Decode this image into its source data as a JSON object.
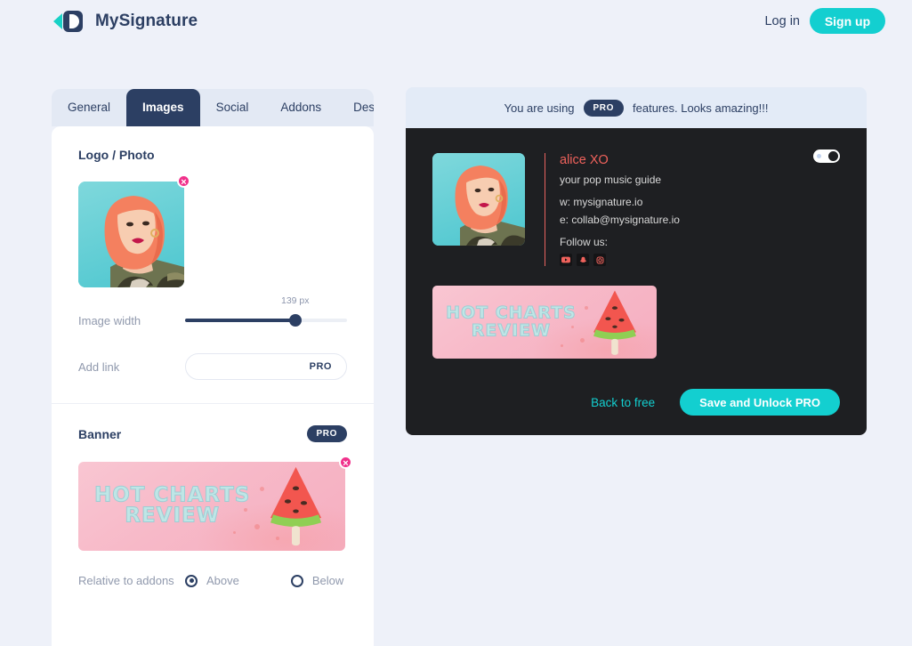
{
  "header": {
    "brand_name": "MySignature",
    "login_label": "Log in",
    "signup_label": "Sign up",
    "logo_icon": "mysignature-logo-icon",
    "accent_color": "#13cfd0",
    "navy_color": "#2c3f63"
  },
  "editor": {
    "tabs": [
      {
        "label": "General",
        "active": false
      },
      {
        "label": "Images",
        "active": true
      },
      {
        "label": "Social",
        "active": false
      },
      {
        "label": "Addons",
        "active": false
      },
      {
        "label": "Design",
        "active": false
      }
    ],
    "logo_section": {
      "title": "Logo / Photo",
      "delete_icon": "close-icon",
      "image_width": {
        "label": "Image width",
        "value": "139 px",
        "fill_percent": 68
      },
      "add_link": {
        "label": "Add link",
        "value": "",
        "placeholder": "",
        "badge": "PRO"
      }
    },
    "banner_section": {
      "title": "Banner",
      "badge": "PRO",
      "delete_icon": "close-icon",
      "relative": {
        "label": "Relative to addons",
        "options": [
          {
            "label": "Above",
            "selected": true
          },
          {
            "label": "Below",
            "selected": false
          }
        ]
      }
    }
  },
  "preview": {
    "pro_bar": {
      "text_before": "You are using",
      "badge": "PRO",
      "text_after": "features. Looks amazing!!!"
    },
    "toggle_icon": "preview-toggle",
    "signature": {
      "name": "alice XO",
      "tagline": "your pop music guide",
      "website": "w: mysignature.io",
      "email": "e: collab@mysignature.io",
      "follow_label": "Follow us:",
      "socials": [
        {
          "name": "youtube-icon"
        },
        {
          "name": "snapchat-icon"
        },
        {
          "name": "instagram-icon"
        }
      ],
      "name_color": "#f0625c"
    },
    "actions": {
      "back_label": "Back to free",
      "save_label": "Save and Unlock PRO"
    }
  },
  "banner_art": {
    "line1": "HOT CHARTS",
    "line2": "REVIEW",
    "text_color": "#bfe6e6",
    "bg_color": "#f7b9c8"
  }
}
